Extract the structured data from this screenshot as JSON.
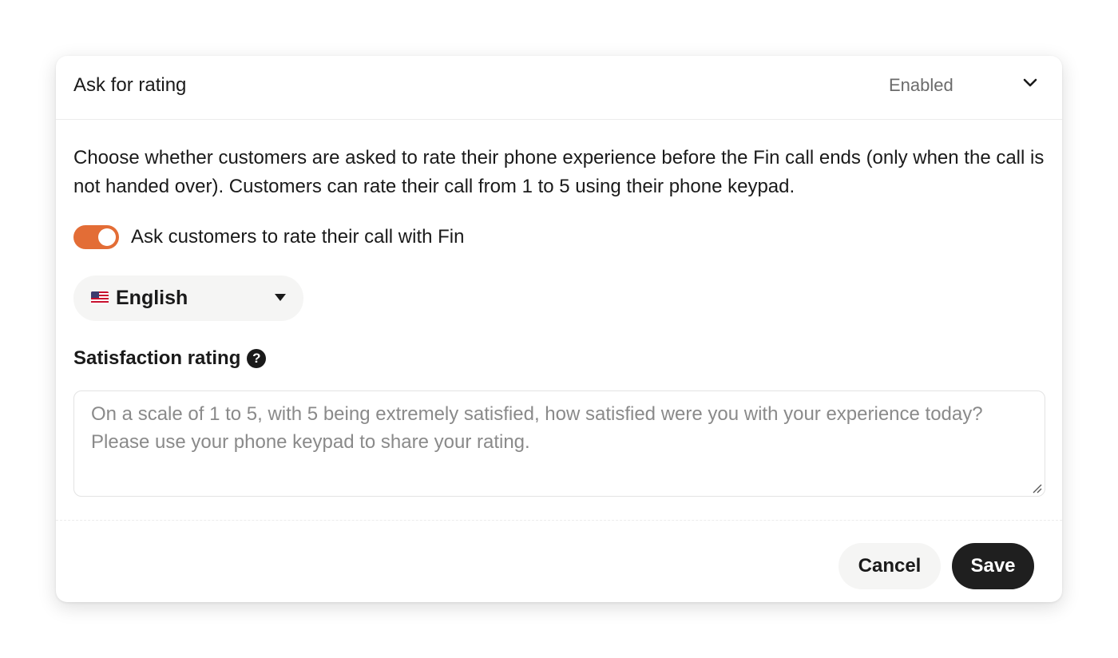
{
  "panel": {
    "title": "Ask for rating",
    "status": "Enabled",
    "expand_icon": "chevron-down-icon"
  },
  "description": "Choose whether customers are asked to rate their phone experience before the Fin call ends (only when the call is not handed over). Customers can rate their call from 1 to 5 using their phone keypad.",
  "toggle": {
    "label": "Ask customers to rate their call with Fin",
    "on": true,
    "color": "#e36d36"
  },
  "language": {
    "selected": "English",
    "flag_icon": "us-flag-icon",
    "caret_icon": "caret-down-icon"
  },
  "satisfaction": {
    "title": "Satisfaction rating",
    "help_icon": "question-circle-icon",
    "help_glyph": "?",
    "placeholder": "On a scale of 1 to 5, with 5 being extremely satisfied, how satisfied were you with your experience today? Please use your phone keypad to share your rating.",
    "value": ""
  },
  "actions": {
    "cancel_label": "Cancel",
    "save_label": "Save"
  }
}
